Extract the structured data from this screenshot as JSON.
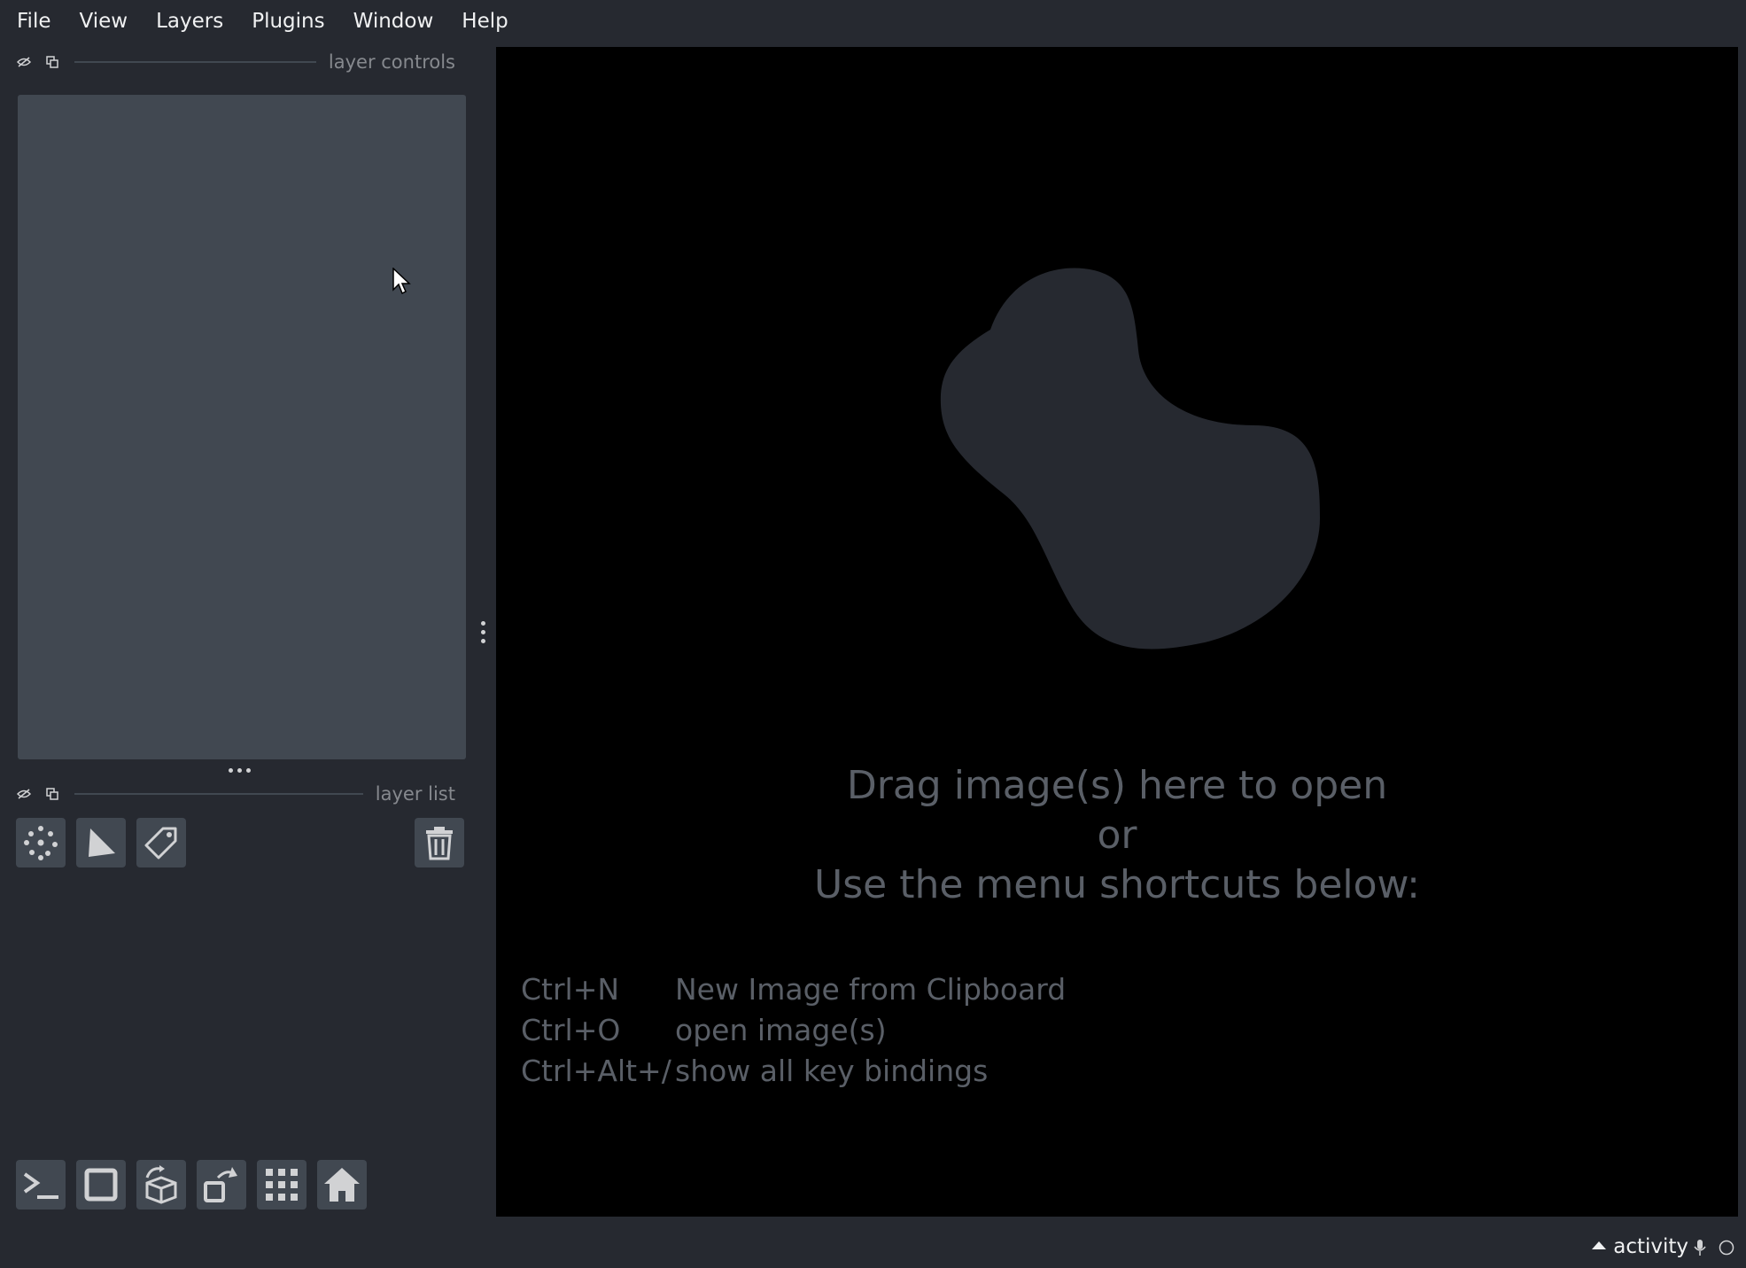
{
  "menu": {
    "items": [
      {
        "label": "File"
      },
      {
        "label": "View"
      },
      {
        "label": "Layers"
      },
      {
        "label": "Plugins"
      },
      {
        "label": "Window"
      },
      {
        "label": "Help"
      }
    ]
  },
  "layer_controls": {
    "title": "layer controls"
  },
  "layer_list": {
    "title": "layer list"
  },
  "welcome": {
    "line1": "Drag image(s) here to open",
    "line2": "or",
    "line3": "Use the menu shortcuts below:",
    "shortcuts": [
      {
        "key": "Ctrl+N",
        "desc": "New Image from Clipboard"
      },
      {
        "key": "Ctrl+O",
        "desc": "open image(s)"
      },
      {
        "key": "Ctrl+Alt+/",
        "desc": "show all key bindings"
      }
    ]
  },
  "status": {
    "activity_label": "activity"
  },
  "colors": {
    "background": "#262930",
    "panel": "#414851",
    "canvas": "#000000",
    "blob": "#262930",
    "text_primary": "#f0f1f2",
    "text_muted": "#5a5f67"
  }
}
